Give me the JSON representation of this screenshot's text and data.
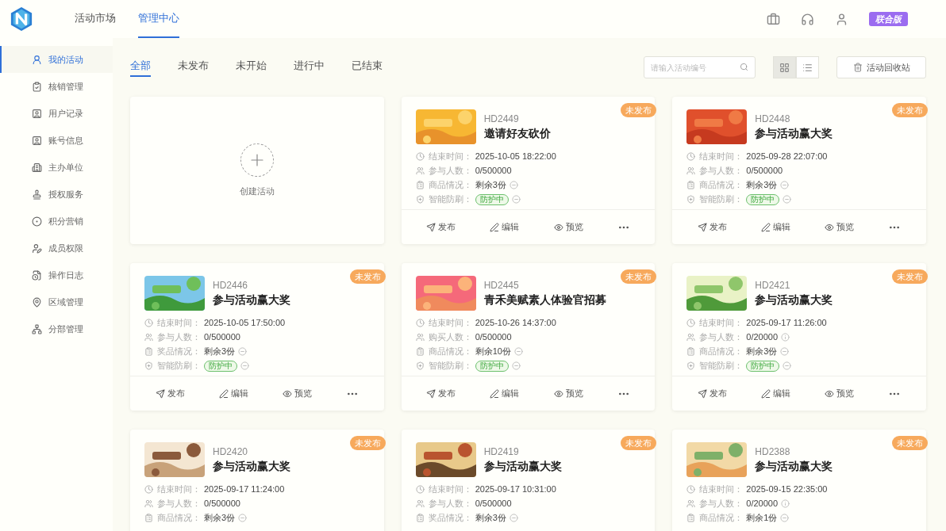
{
  "header": {
    "nav": [
      {
        "label": "活动市场",
        "selected": false
      },
      {
        "label": "管理中心",
        "selected": true
      }
    ],
    "edition": "联合版"
  },
  "sidebar": {
    "items": [
      {
        "label": "我的活动",
        "selected": true
      },
      {
        "label": "核销管理",
        "selected": false
      },
      {
        "label": "用户记录",
        "selected": false
      },
      {
        "label": "账号信息",
        "selected": false
      },
      {
        "label": "主办单位",
        "selected": false
      },
      {
        "label": "授权服务",
        "selected": false
      },
      {
        "label": "积分营销",
        "selected": false
      },
      {
        "label": "成员权限",
        "selected": false
      },
      {
        "label": "操作日志",
        "selected": false
      },
      {
        "label": "区域管理",
        "selected": false
      },
      {
        "label": "分部管理",
        "selected": false
      }
    ]
  },
  "tabs": [
    {
      "label": "全部",
      "selected": true
    },
    {
      "label": "未发布",
      "selected": false
    },
    {
      "label": "未开始",
      "selected": false
    },
    {
      "label": "进行中",
      "selected": false
    },
    {
      "label": "已结束",
      "selected": false
    }
  ],
  "search": {
    "placeholder": "请输入活动编号"
  },
  "view_toggle": [
    {
      "kind": "grid",
      "selected": true
    },
    {
      "kind": "list",
      "selected": false
    }
  ],
  "recycle_button": "活动回收站",
  "cards": [
    {
      "kind": "create",
      "label": "创建活动"
    },
    {
      "kind": "activity",
      "id": "HD2449",
      "title": "邀请好友砍价",
      "status": "未发布",
      "rows": [
        {
          "kind": "time",
          "label": "结束时间：",
          "value": "2025-10-05 18:22:00"
        },
        {
          "kind": "people",
          "label": "参与人数：",
          "value": "0/500000"
        },
        {
          "kind": "goods",
          "label": "商品情况：",
          "value": "剩余3份",
          "suffix": {
            "kind": "minus"
          }
        },
        {
          "kind": "protect",
          "label": "智能防刷：",
          "value": "防护中",
          "suffix": {
            "kind": "minus"
          }
        }
      ],
      "actions": [
        "发布",
        "编辑",
        "预览"
      ]
    },
    {
      "kind": "activity",
      "id": "HD2448",
      "title": "参与活动赢大奖",
      "status": "未发布",
      "rows": [
        {
          "kind": "time",
          "label": "结束时间：",
          "value": "2025-09-28 22:07:00"
        },
        {
          "kind": "people",
          "label": "参与人数：",
          "value": "0/500000"
        },
        {
          "kind": "goods",
          "label": "商品情况：",
          "value": "剩余3份",
          "suffix": {
            "kind": "minus"
          }
        },
        {
          "kind": "protect",
          "label": "智能防刷：",
          "value": "防护中",
          "suffix": {
            "kind": "minus"
          }
        }
      ],
      "actions": [
        "发布",
        "编辑",
        "预览"
      ]
    },
    {
      "kind": "activity",
      "id": "HD2446",
      "title": "参与活动赢大奖",
      "status": "未发布",
      "rows": [
        {
          "kind": "time",
          "label": "结束时间：",
          "value": "2025-10-05 17:50:00"
        },
        {
          "kind": "people",
          "label": "参与人数：",
          "value": "0/500000"
        },
        {
          "kind": "goods",
          "label": "奖品情况：",
          "value": "剩余3份",
          "suffix": {
            "kind": "minus"
          }
        },
        {
          "kind": "protect",
          "label": "智能防刷：",
          "value": "防护中",
          "suffix": {
            "kind": "minus"
          }
        }
      ],
      "actions": [
        "发布",
        "编辑",
        "预览"
      ]
    },
    {
      "kind": "activity",
      "id": "HD2445",
      "title": "青禾美赋素人体验官招募",
      "status": "未发布",
      "rows": [
        {
          "kind": "time",
          "label": "结束时间：",
          "value": "2025-10-26 14:37:00"
        },
        {
          "kind": "people",
          "label": "购买人数：",
          "value": "0/500000"
        },
        {
          "kind": "goods",
          "label": "商品情况：",
          "value": "剩余10份",
          "suffix": {
            "kind": "minus"
          }
        },
        {
          "kind": "protect",
          "label": "智能防刷：",
          "value": "防护中",
          "suffix": {
            "kind": "minus"
          }
        }
      ],
      "actions": [
        "发布",
        "编辑",
        "预览"
      ]
    },
    {
      "kind": "activity",
      "id": "HD2421",
      "title": "参与活动赢大奖",
      "status": "未发布",
      "rows": [
        {
          "kind": "time",
          "label": "结束时间：",
          "value": "2025-09-17 11:26:00"
        },
        {
          "kind": "people",
          "label": "参与人数：",
          "value": "0/20000",
          "suffix": {
            "kind": "info"
          }
        },
        {
          "kind": "goods",
          "label": "商品情况：",
          "value": "剩余3份",
          "suffix": {
            "kind": "minus"
          }
        },
        {
          "kind": "protect",
          "label": "智能防刷：",
          "value": "防护中",
          "suffix": {
            "kind": "minus"
          }
        }
      ],
      "actions": [
        "发布",
        "编辑",
        "预览"
      ]
    },
    {
      "kind": "activity",
      "id": "HD2420",
      "title": "参与活动赢大奖",
      "status": "未发布",
      "rows": [
        {
          "kind": "time",
          "label": "结束时间：",
          "value": "2025-09-17 11:24:00"
        },
        {
          "kind": "people",
          "label": "参与人数：",
          "value": "0/500000"
        },
        {
          "kind": "goods",
          "label": "商品情况：",
          "value": "剩余3份",
          "suffix": {
            "kind": "minus"
          }
        }
      ]
    },
    {
      "kind": "activity",
      "id": "HD2419",
      "title": "参与活动赢大奖",
      "status": "未发布",
      "rows": [
        {
          "kind": "time",
          "label": "结束时间：",
          "value": "2025-09-17 10:31:00"
        },
        {
          "kind": "people",
          "label": "参与人数：",
          "value": "0/500000"
        },
        {
          "kind": "goods",
          "label": "奖品情况：",
          "value": "剩余3份",
          "suffix": {
            "kind": "minus"
          }
        }
      ]
    },
    {
      "kind": "activity",
      "id": "HD2388",
      "title": "参与活动赢大奖",
      "status": "未发布",
      "rows": [
        {
          "kind": "time",
          "label": "结束时间：",
          "value": "2025-09-15 22:35:00"
        },
        {
          "kind": "people",
          "label": "参与人数：",
          "value": "0/20000",
          "suffix": {
            "kind": "info"
          }
        },
        {
          "kind": "goods",
          "label": "商品情况：",
          "value": "剩余1份",
          "suffix": {
            "kind": "minus"
          }
        }
      ]
    }
  ]
}
